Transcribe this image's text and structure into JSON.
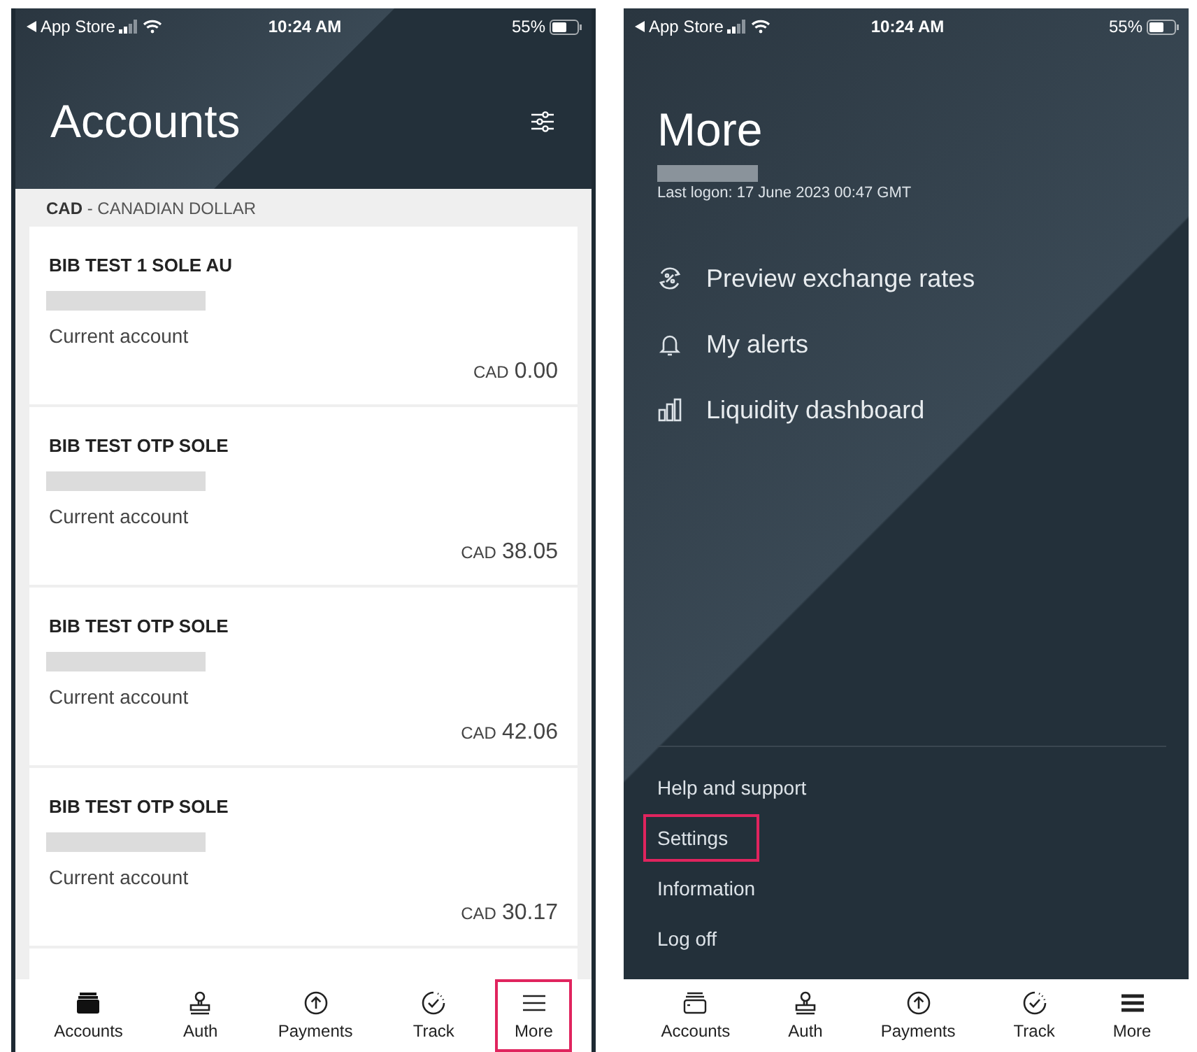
{
  "screens": [
    {
      "kind": "accounts",
      "status_bar": {
        "back_label": "App Store",
        "time": "10:24 AM",
        "battery": "55%"
      },
      "title": "Accounts",
      "currency_header": {
        "code": "CAD",
        "name": " - CANADIAN DOLLAR"
      },
      "accounts": [
        {
          "name": "BIB TEST 1 SOLE AU",
          "type": "Current account",
          "currency": "CAD",
          "balance": "0.00"
        },
        {
          "name": "BIB TEST OTP SOLE",
          "type": "Current account",
          "currency": "CAD",
          "balance": "38.05"
        },
        {
          "name": "BIB TEST OTP SOLE",
          "type": "Current account",
          "currency": "CAD",
          "balance": "42.06"
        },
        {
          "name": "BIB TEST OTP SOLE",
          "type": "Current account",
          "currency": "CAD",
          "balance": "30.17"
        }
      ],
      "tabs": [
        {
          "label": "Accounts",
          "selected": true,
          "highlighted": false
        },
        {
          "label": "Auth",
          "selected": false,
          "highlighted": false
        },
        {
          "label": "Payments",
          "selected": false,
          "highlighted": false
        },
        {
          "label": "Track",
          "selected": false,
          "highlighted": false
        },
        {
          "label": "More",
          "selected": false,
          "highlighted": true
        }
      ]
    },
    {
      "kind": "more",
      "status_bar": {
        "back_label": "App Store",
        "time": "10:24 AM",
        "battery": "55%"
      },
      "title": "More",
      "last_logon": "Last logon: 17 June 2023 00:47 GMT",
      "menu": [
        {
          "label": "Preview exchange rates"
        },
        {
          "label": "My alerts"
        },
        {
          "label": "Liquidity dashboard"
        }
      ],
      "links": [
        {
          "label": "Help and support",
          "highlighted": false
        },
        {
          "label": "Settings",
          "highlighted": true
        },
        {
          "label": "Information",
          "highlighted": false
        },
        {
          "label": "Log off",
          "highlighted": false
        }
      ],
      "tabs": [
        {
          "label": "Accounts",
          "selected": false,
          "highlighted": false
        },
        {
          "label": "Auth",
          "selected": false,
          "highlighted": false
        },
        {
          "label": "Payments",
          "selected": false,
          "highlighted": false
        },
        {
          "label": "Track",
          "selected": false,
          "highlighted": false
        },
        {
          "label": "More",
          "selected": true,
          "highlighted": false
        }
      ]
    }
  ]
}
